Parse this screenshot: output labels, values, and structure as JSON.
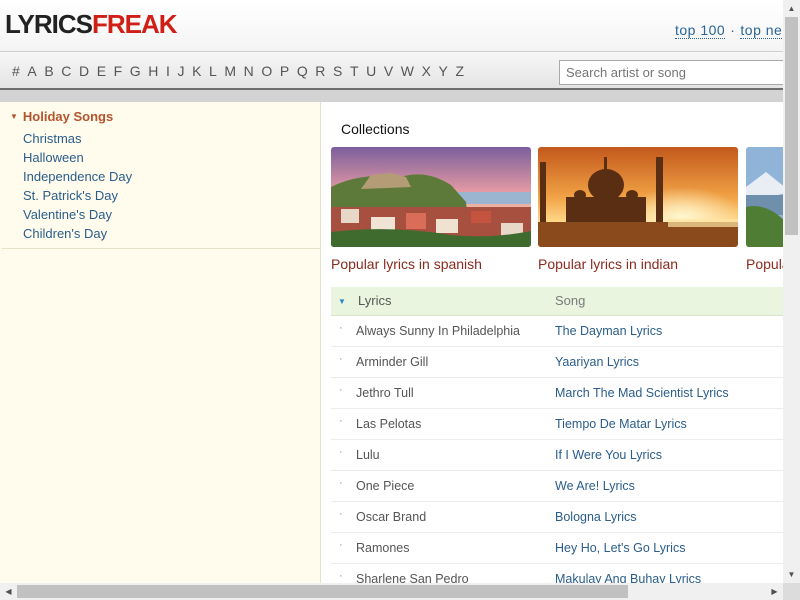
{
  "header": {
    "logo_part1": "LYRICS",
    "logo_part2": "FREAK",
    "links": [
      "top 100",
      "top ne"
    ],
    "separator": "·"
  },
  "alphabet": [
    "#",
    "A",
    "B",
    "C",
    "D",
    "E",
    "F",
    "G",
    "H",
    "I",
    "J",
    "K",
    "L",
    "M",
    "N",
    "O",
    "P",
    "Q",
    "R",
    "S",
    "T",
    "U",
    "V",
    "W",
    "X",
    "Y",
    "Z"
  ],
  "search": {
    "placeholder": "Search artist or song"
  },
  "sidebar": {
    "title": "Holiday Songs",
    "items": [
      "Christmas",
      "Halloween",
      "Independence Day",
      "St. Patrick's Day",
      "Valentine's Day",
      "Children's Day"
    ]
  },
  "collections": {
    "title": "Collections",
    "cards": [
      {
        "caption": "Popular lyrics in spanish",
        "image": "lisbon-cityscape"
      },
      {
        "caption": "Popular lyrics in indian",
        "image": "taj-mahal-sunset"
      },
      {
        "caption": "Popula",
        "image": "mountain-lake"
      }
    ]
  },
  "table": {
    "headers": [
      "Lyrics",
      "Song"
    ],
    "rows": [
      {
        "artist": "Always Sunny In Philadelphia",
        "song": "The Dayman Lyrics"
      },
      {
        "artist": "Arminder Gill",
        "song": "Yaariyan Lyrics"
      },
      {
        "artist": "Jethro Tull",
        "song": "March The Mad Scientist Lyrics"
      },
      {
        "artist": "Las Pelotas",
        "song": "Tiempo De Matar Lyrics"
      },
      {
        "artist": "Lulu",
        "song": "If I Were You Lyrics"
      },
      {
        "artist": "One Piece",
        "song": "We Are! Lyrics"
      },
      {
        "artist": "Oscar Brand",
        "song": "Bologna Lyrics"
      },
      {
        "artist": "Ramones",
        "song": "Hey Ho, Let's Go Lyrics"
      },
      {
        "artist": "Sharlene San Pedro",
        "song": "Makulay Ang Buhay Lyrics"
      }
    ]
  },
  "colors": {
    "brand_red": "#d01f16",
    "link_blue": "#2a5d8a",
    "sidebar_bg": "#fffcee",
    "table_head_bg": "#eaf5e0"
  }
}
